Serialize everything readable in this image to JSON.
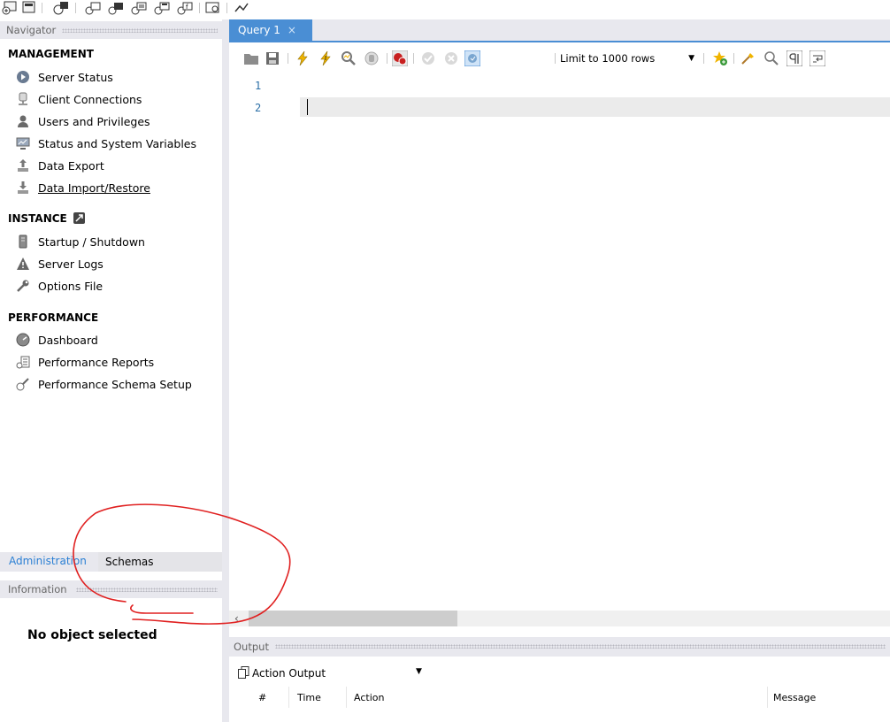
{
  "navigator": {
    "header": "Navigator",
    "management": {
      "title": "MANAGEMENT",
      "items": [
        {
          "label": "Server Status",
          "icon": "play-circle-icon"
        },
        {
          "label": "Client Connections",
          "icon": "client-connections-icon"
        },
        {
          "label": "Users and Privileges",
          "icon": "user-icon"
        },
        {
          "label": "Status and System Variables",
          "icon": "monitor-icon"
        },
        {
          "label": "Data Export",
          "icon": "export-icon"
        },
        {
          "label": "Data Import/Restore",
          "icon": "import-icon"
        }
      ]
    },
    "instance": {
      "title": "INSTANCE",
      "items": [
        {
          "label": "Startup / Shutdown",
          "icon": "server-icon"
        },
        {
          "label": "Server Logs",
          "icon": "warning-icon"
        },
        {
          "label": "Options File",
          "icon": "wrench-icon"
        }
      ]
    },
    "performance": {
      "title": "PERFORMANCE",
      "items": [
        {
          "label": "Dashboard",
          "icon": "dashboard-icon"
        },
        {
          "label": "Performance Reports",
          "icon": "reports-icon"
        },
        {
          "label": "Performance Schema Setup",
          "icon": "schema-setup-icon"
        }
      ]
    },
    "tabs": {
      "administration": "Administration",
      "schemas": "Schemas"
    }
  },
  "information": {
    "header": "Information",
    "empty_text": "No object selected"
  },
  "query": {
    "tab_label": "Query 1",
    "tab_close": "×",
    "limit_label": "Limit to 1000 rows",
    "line_numbers": [
      "1",
      "2"
    ]
  },
  "output": {
    "header": "Output",
    "selector": "Action Output",
    "columns": {
      "num": "#",
      "time": "Time",
      "action": "Action",
      "message": "Message"
    }
  },
  "colors": {
    "accent": "#4a8ed4",
    "link": "#2a7fd4",
    "annotation": "#e02020"
  }
}
